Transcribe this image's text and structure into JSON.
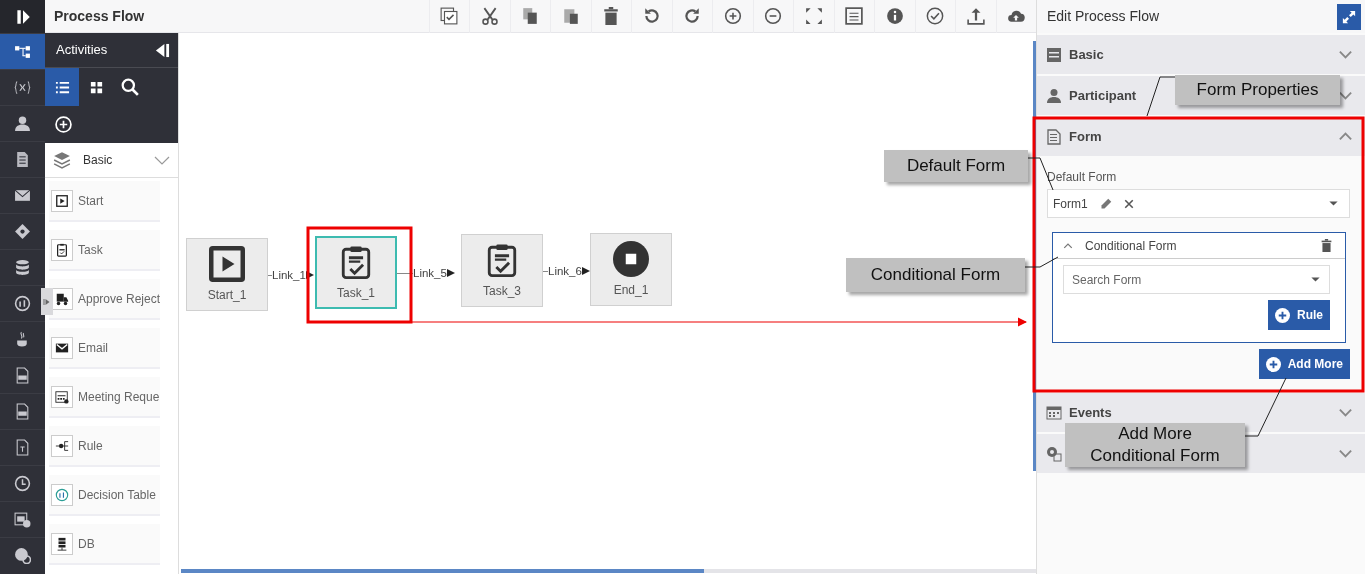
{
  "app": {
    "title": "Process Flow"
  },
  "rail_items": [
    {
      "selected": true
    },
    {
      "selected": false
    },
    {
      "selected": false
    },
    {
      "selected": false
    },
    {
      "selected": false
    },
    {
      "selected": false
    },
    {
      "selected": false
    },
    {
      "selected": false
    },
    {
      "selected": false
    },
    {
      "selected": false
    },
    {
      "selected": false
    },
    {
      "selected": false
    },
    {
      "selected": false
    },
    {
      "selected": false
    },
    {
      "selected": false
    }
  ],
  "activities": {
    "title": "Activities",
    "view_buttons": [
      {
        "selected": true
      },
      {
        "selected": false
      },
      {
        "selected": false
      }
    ],
    "group": {
      "label": "Basic",
      "expanded": false
    },
    "items": [
      {
        "label": "Start"
      },
      {
        "label": "Task"
      },
      {
        "label": "Approve Reject"
      },
      {
        "label": "Email"
      },
      {
        "label": "Meeting Reque"
      },
      {
        "label": "Rule"
      },
      {
        "label": "Decision Table"
      },
      {
        "label": "DB"
      }
    ]
  },
  "canvas": {
    "nodes": [
      {
        "label": "Start_1",
        "kind": "start",
        "selected": false
      },
      {
        "label": "Task_1",
        "kind": "task",
        "selected": true
      },
      {
        "label": "Task_3",
        "kind": "task",
        "selected": false
      },
      {
        "label": "End_1",
        "kind": "end",
        "selected": false
      }
    ],
    "links": [
      {
        "label": "Link_1"
      },
      {
        "label": "Link_5"
      },
      {
        "label": "Link_6"
      }
    ]
  },
  "properties": {
    "title": "Edit Process Flow",
    "sections": [
      {
        "title": "Basic",
        "expanded": false
      },
      {
        "title": "Participant",
        "expanded": false
      },
      {
        "title": "Form",
        "expanded": true
      },
      {
        "title": "Events",
        "expanded": false
      },
      {
        "expanded": false
      }
    ],
    "form": {
      "default_label": "Default Form",
      "default_value": "Form1",
      "conditional": {
        "title": "Conditional Form",
        "expanded": true,
        "placeholder": "Search Form",
        "rule_button": "Rule"
      },
      "add_button": "Add More"
    }
  },
  "annotations": [
    {
      "lines": [
        "Form Properties"
      ]
    },
    {
      "lines": [
        "Default Form"
      ]
    },
    {
      "lines": [
        "Conditional Form"
      ]
    },
    {
      "lines": [
        "Add More",
        "Conditional Form"
      ]
    }
  ]
}
